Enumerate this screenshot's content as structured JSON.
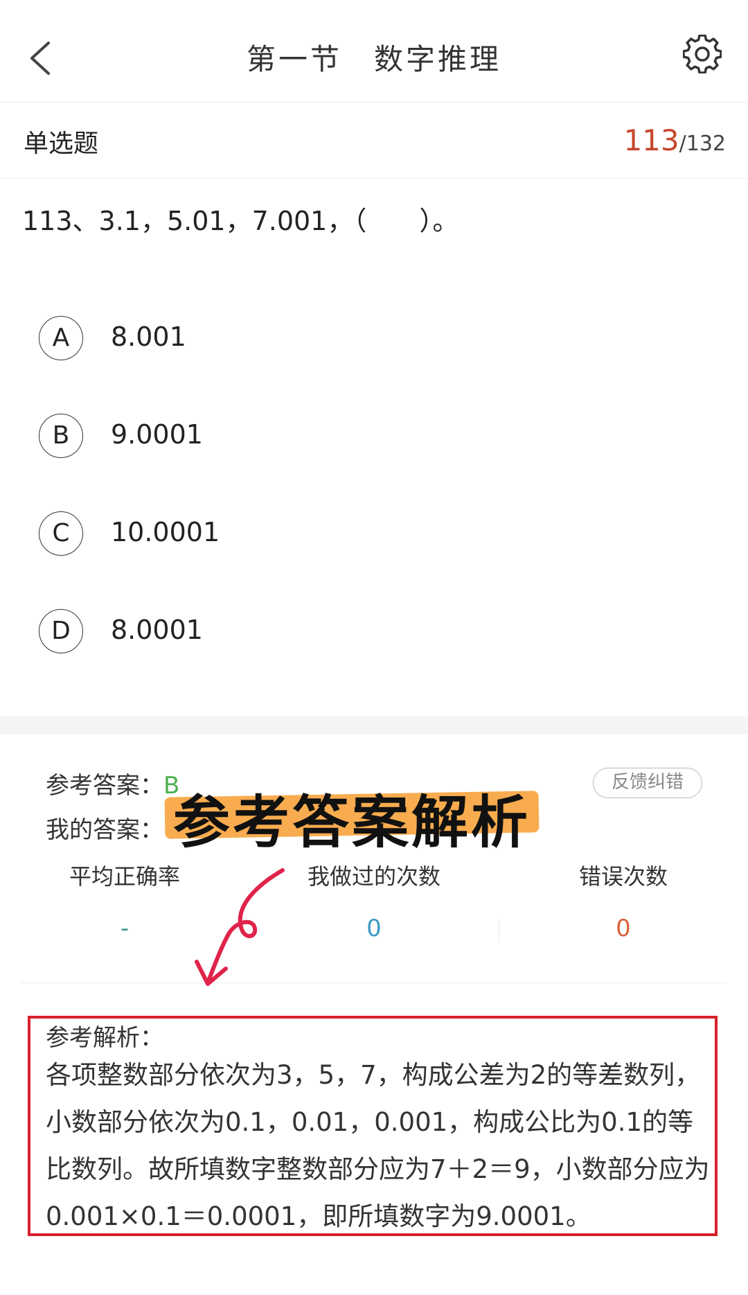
{
  "header": {
    "title": "第一节　数字推理",
    "back_icon": "chevron-left-icon",
    "settings_icon": "gear-icon"
  },
  "question_bar": {
    "type_label": "单选题",
    "current": "113",
    "total": "/132"
  },
  "question": {
    "text": "113、3.1，5.01，7.001，（　　）。"
  },
  "options": [
    {
      "letter": "A",
      "text": "8.001"
    },
    {
      "letter": "B",
      "text": "9.0001"
    },
    {
      "letter": "C",
      "text": "10.0001"
    },
    {
      "letter": "D",
      "text": "8.0001"
    }
  ],
  "answer": {
    "reference_label": "参考答案：",
    "reference_value": "B",
    "mine_label": "我的答案：",
    "feedback_label": "反馈纠错",
    "overlay_caption": "参考答案解析"
  },
  "stats": [
    {
      "label": "平均正确率",
      "value": "-",
      "color": "#4a9b8e"
    },
    {
      "label": "我做过的次数",
      "value": "0",
      "color": "#3a9bc4"
    },
    {
      "label": "错误次数",
      "value": "0",
      "color": "#d9603d"
    }
  ],
  "analysis": {
    "title": "参考解析：",
    "body": "各项整数部分依次为3，5，7，构成公差为2的等差数列，小数部分依次为0.1，0.01，0.001，构成公比为0.1的等比数列。故所填数字整数部分应为7＋2＝9，小数部分应为0.001×0.1＝0.0001，即所填数字为9.0001。"
  },
  "colors": {
    "accent_red": "#c7472d",
    "highlight_orange": "#f7a540",
    "box_red": "#d8202c",
    "answer_green": "#4caf50"
  }
}
